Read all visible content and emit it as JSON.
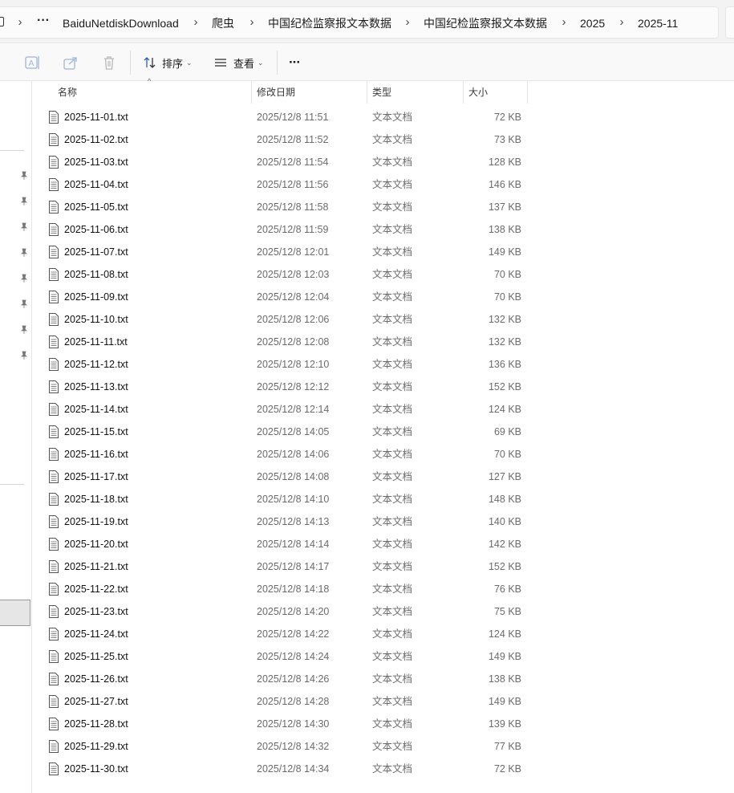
{
  "breadcrumb": {
    "more_label": "···",
    "items": [
      {
        "label": "BaiduNetdiskDownload"
      },
      {
        "label": "爬虫"
      },
      {
        "label": "中国纪检监察报文本数据"
      },
      {
        "label": "中国纪检监察报文本数据"
      },
      {
        "label": "2025"
      },
      {
        "label": "2025-11"
      }
    ]
  },
  "toolbar": {
    "sort_label": "排序",
    "view_label": "查看",
    "more_label": "···"
  },
  "columns": {
    "name": "名称",
    "date": "修改日期",
    "type": "类型",
    "size": "大小"
  },
  "files": [
    {
      "name": "2025-11-01.txt",
      "date": "2025/12/8 11:51",
      "type": "文本文档",
      "size": "72 KB"
    },
    {
      "name": "2025-11-02.txt",
      "date": "2025/12/8 11:52",
      "type": "文本文档",
      "size": "73 KB"
    },
    {
      "name": "2025-11-03.txt",
      "date": "2025/12/8 11:54",
      "type": "文本文档",
      "size": "128 KB"
    },
    {
      "name": "2025-11-04.txt",
      "date": "2025/12/8 11:56",
      "type": "文本文档",
      "size": "146 KB"
    },
    {
      "name": "2025-11-05.txt",
      "date": "2025/12/8 11:58",
      "type": "文本文档",
      "size": "137 KB"
    },
    {
      "name": "2025-11-06.txt",
      "date": "2025/12/8 11:59",
      "type": "文本文档",
      "size": "138 KB"
    },
    {
      "name": "2025-11-07.txt",
      "date": "2025/12/8 12:01",
      "type": "文本文档",
      "size": "149 KB"
    },
    {
      "name": "2025-11-08.txt",
      "date": "2025/12/8 12:03",
      "type": "文本文档",
      "size": "70 KB"
    },
    {
      "name": "2025-11-09.txt",
      "date": "2025/12/8 12:04",
      "type": "文本文档",
      "size": "70 KB"
    },
    {
      "name": "2025-11-10.txt",
      "date": "2025/12/8 12:06",
      "type": "文本文档",
      "size": "132 KB"
    },
    {
      "name": "2025-11-11.txt",
      "date": "2025/12/8 12:08",
      "type": "文本文档",
      "size": "132 KB"
    },
    {
      "name": "2025-11-12.txt",
      "date": "2025/12/8 12:10",
      "type": "文本文档",
      "size": "136 KB"
    },
    {
      "name": "2025-11-13.txt",
      "date": "2025/12/8 12:12",
      "type": "文本文档",
      "size": "152 KB"
    },
    {
      "name": "2025-11-14.txt",
      "date": "2025/12/8 12:14",
      "type": "文本文档",
      "size": "124 KB"
    },
    {
      "name": "2025-11-15.txt",
      "date": "2025/12/8 14:05",
      "type": "文本文档",
      "size": "69 KB"
    },
    {
      "name": "2025-11-16.txt",
      "date": "2025/12/8 14:06",
      "type": "文本文档",
      "size": "70 KB"
    },
    {
      "name": "2025-11-17.txt",
      "date": "2025/12/8 14:08",
      "type": "文本文档",
      "size": "127 KB"
    },
    {
      "name": "2025-11-18.txt",
      "date": "2025/12/8 14:10",
      "type": "文本文档",
      "size": "148 KB"
    },
    {
      "name": "2025-11-19.txt",
      "date": "2025/12/8 14:13",
      "type": "文本文档",
      "size": "140 KB"
    },
    {
      "name": "2025-11-20.txt",
      "date": "2025/12/8 14:14",
      "type": "文本文档",
      "size": "142 KB"
    },
    {
      "name": "2025-11-21.txt",
      "date": "2025/12/8 14:17",
      "type": "文本文档",
      "size": "152 KB"
    },
    {
      "name": "2025-11-22.txt",
      "date": "2025/12/8 14:18",
      "type": "文本文档",
      "size": "76 KB"
    },
    {
      "name": "2025-11-23.txt",
      "date": "2025/12/8 14:20",
      "type": "文本文档",
      "size": "75 KB"
    },
    {
      "name": "2025-11-24.txt",
      "date": "2025/12/8 14:22",
      "type": "文本文档",
      "size": "124 KB"
    },
    {
      "name": "2025-11-25.txt",
      "date": "2025/12/8 14:24",
      "type": "文本文档",
      "size": "149 KB"
    },
    {
      "name": "2025-11-26.txt",
      "date": "2025/12/8 14:26",
      "type": "文本文档",
      "size": "138 KB"
    },
    {
      "name": "2025-11-27.txt",
      "date": "2025/12/8 14:28",
      "type": "文本文档",
      "size": "149 KB"
    },
    {
      "name": "2025-11-28.txt",
      "date": "2025/12/8 14:30",
      "type": "文本文档",
      "size": "139 KB"
    },
    {
      "name": "2025-11-29.txt",
      "date": "2025/12/8 14:32",
      "type": "文本文档",
      "size": "77 KB"
    },
    {
      "name": "2025-11-30.txt",
      "date": "2025/12/8 14:34",
      "type": "文本文档",
      "size": "72 KB"
    }
  ]
}
